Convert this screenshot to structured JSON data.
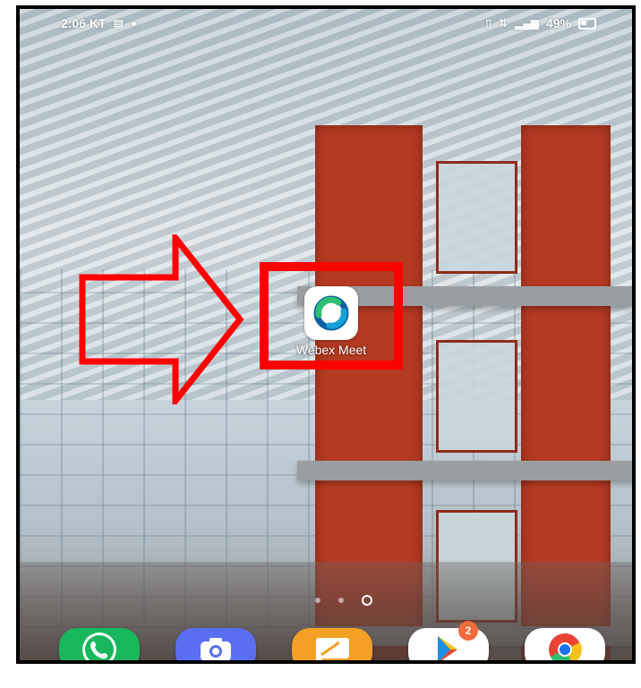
{
  "status_bar": {
    "time_carrier": "2:06 KT",
    "battery_percent": "49%",
    "icons": [
      "message-icon",
      "chat-icon",
      "vibrate-icon",
      "lte-icon",
      "signal-icon",
      "battery-icon"
    ]
  },
  "home_screen": {
    "app": {
      "label": "Webex Meet",
      "icon": "webex-meet-icon"
    },
    "page_indicator": {
      "pages": 3,
      "current": 3
    }
  },
  "annotation": {
    "arrow_color": "#ff0000",
    "box_color": "#ff0000"
  },
  "dock": [
    {
      "name": "phone",
      "icon": "phone-icon",
      "color": "#19b75c"
    },
    {
      "name": "camera",
      "icon": "camera-icon",
      "color": "#5a6ef2"
    },
    {
      "name": "messages",
      "icon": "message-icon",
      "color": "#f4a024"
    },
    {
      "name": "play-store",
      "icon": "play-store-icon",
      "color": "#ffffff",
      "badge": "2",
      "badge_color": "#f26b3a"
    },
    {
      "name": "chrome",
      "icon": "chrome-icon",
      "color": "#ffffff"
    }
  ]
}
